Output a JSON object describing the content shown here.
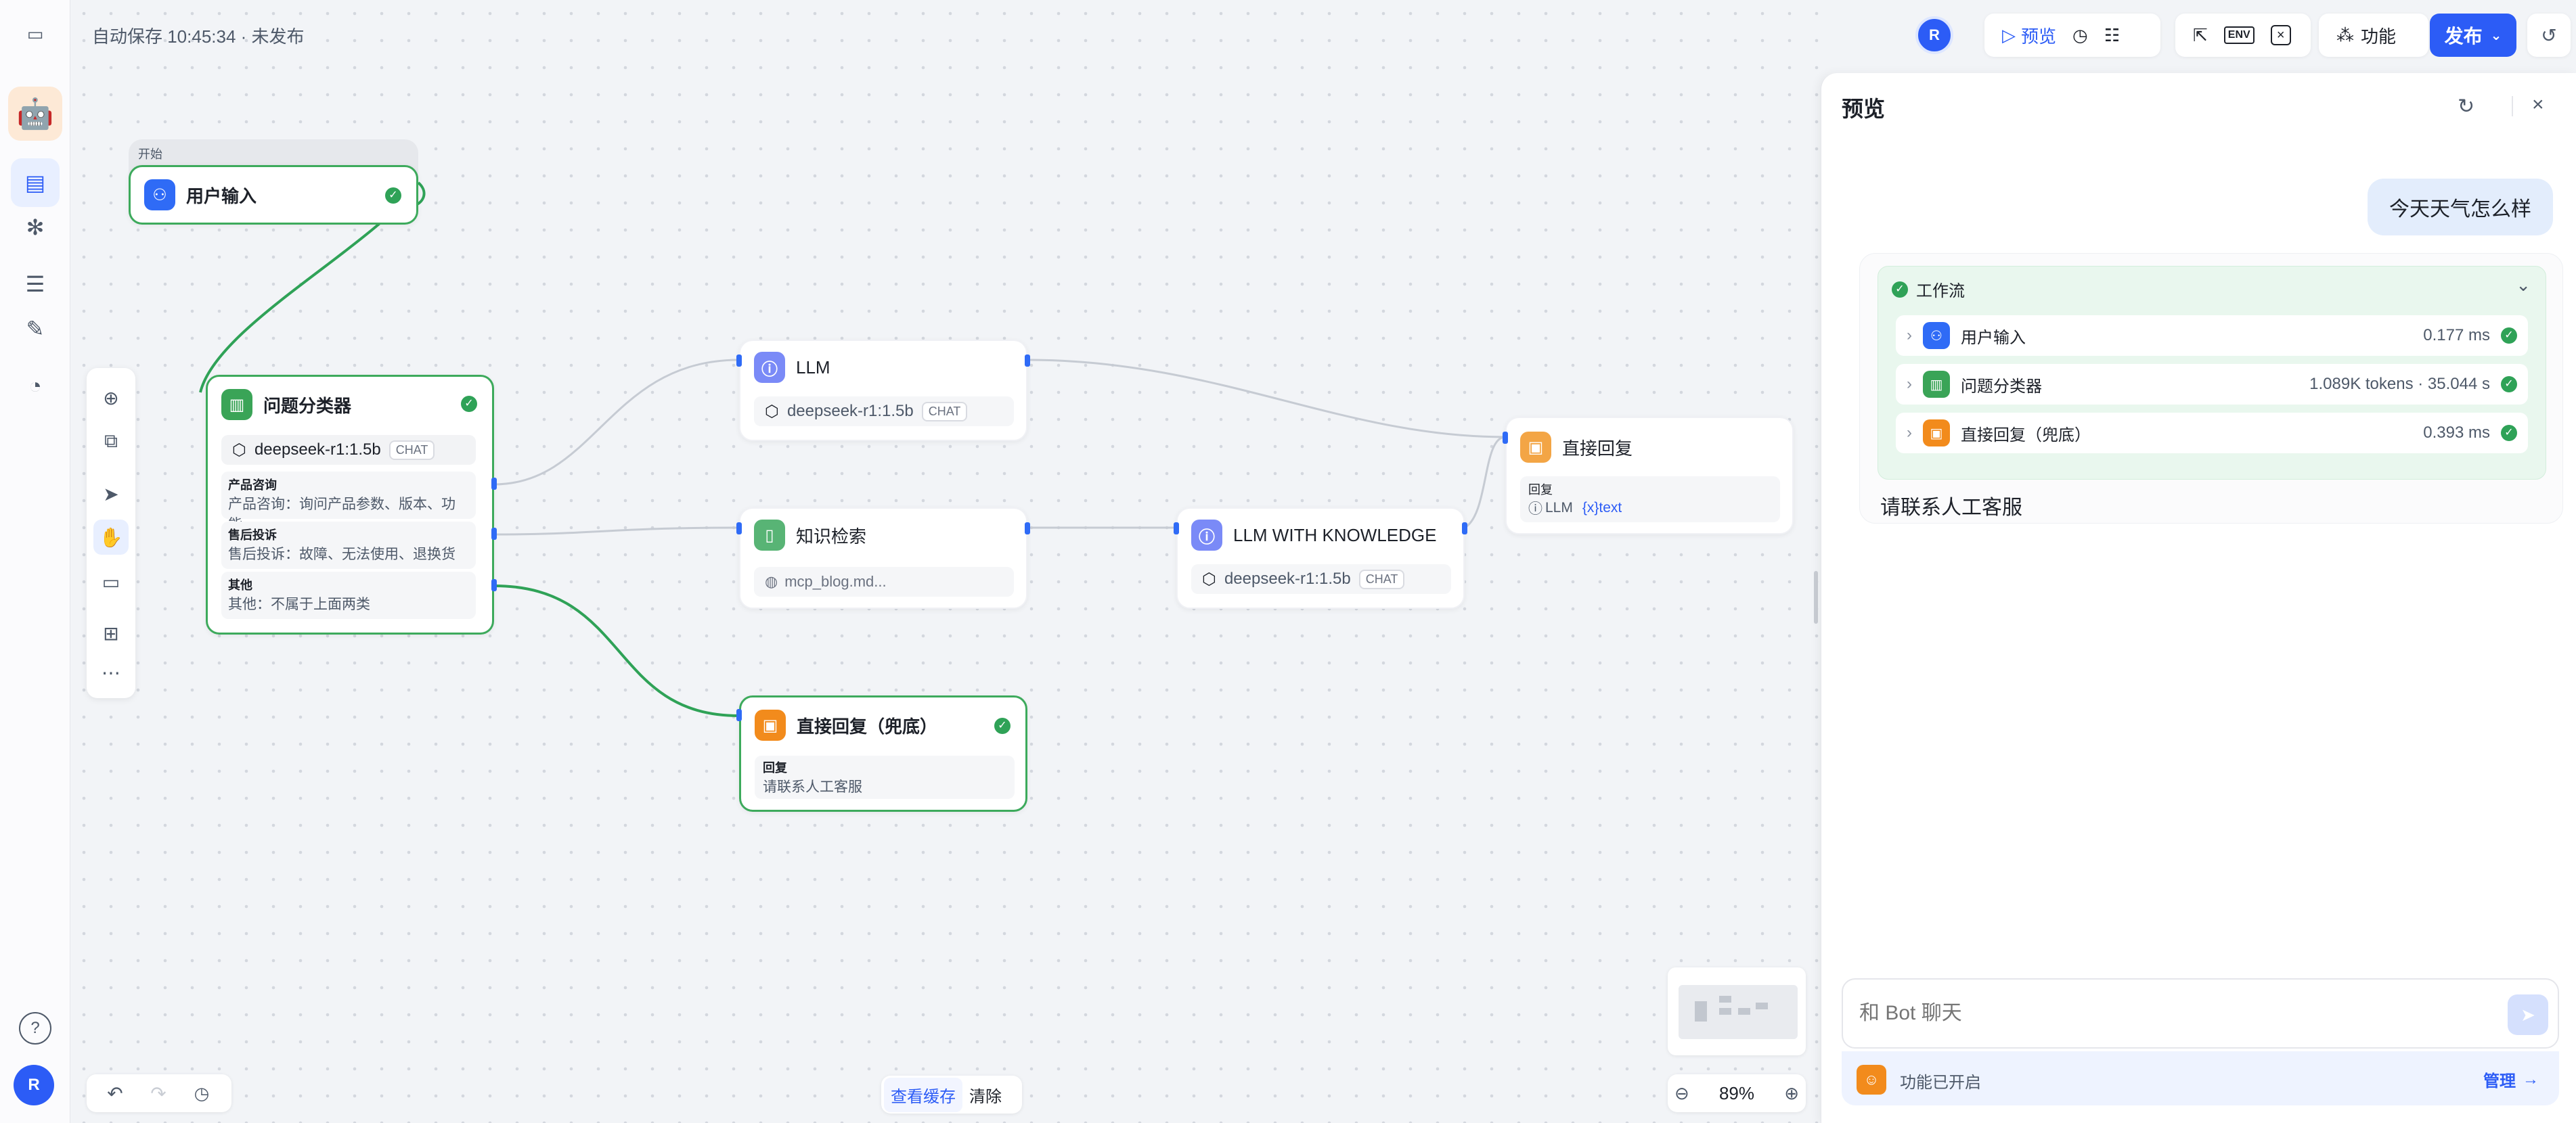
{
  "header": {
    "autosave": "自动保存 10:45:34 · 未发布",
    "avatar": "R",
    "preview_label": "预览",
    "env_label": "ENV",
    "features_label": "功能",
    "publish_label": "发布"
  },
  "sidebar": {
    "avatar": "R",
    "help": "?"
  },
  "nodes": {
    "start": {
      "tag": "开始",
      "title": "用户输入"
    },
    "classifier": {
      "title": "问题分类器",
      "model": "deepseek-r1:1.5b",
      "tag": "CHAT",
      "classes": [
        {
          "label": "产品咨询",
          "text": "产品咨询：询问产品参数、版本、功能"
        },
        {
          "label": "售后投诉",
          "text": "售后投诉：故障、无法使用、退换货"
        },
        {
          "label": "其他",
          "text": "其他：不属于上面两类"
        }
      ]
    },
    "llm": {
      "title": "LLM",
      "model": "deepseek-r1:1.5b",
      "tag": "CHAT"
    },
    "knowledge": {
      "title": "知识检索",
      "dataset": "mcp_blog.md..."
    },
    "llm_knowledge": {
      "title": "LLM WITH KNOWLEDGE",
      "model": "deepseek-r1:1.5b",
      "tag": "CHAT"
    },
    "reply": {
      "title": "直接回复",
      "label": "回复",
      "source": "LLM",
      "var": "{x}text"
    },
    "fallback": {
      "title": "直接回复（兜底）",
      "label": "回复",
      "text": "请联系人工客服"
    }
  },
  "canvas_footer": {
    "view_cache": "查看缓存",
    "clear": "清除",
    "zoom": "89%"
  },
  "preview": {
    "title": "预览",
    "user_message": "今天天气怎么样",
    "workflow_label": "工作流",
    "steps": [
      {
        "name": "用户输入",
        "meta": "0.177 ms"
      },
      {
        "name": "问题分类器",
        "meta": "1.089K tokens · 35.044 s"
      },
      {
        "name": "直接回复（兜底）",
        "meta": "0.393 ms"
      }
    ],
    "answer": "请联系人工客服",
    "input_placeholder": "和 Bot 聊天",
    "features_enabled": "功能已开启",
    "manage": "管理"
  },
  "colors": {
    "accent": "#2c5cf6",
    "success": "#2fa257",
    "selected_border": "#3daa5c"
  }
}
